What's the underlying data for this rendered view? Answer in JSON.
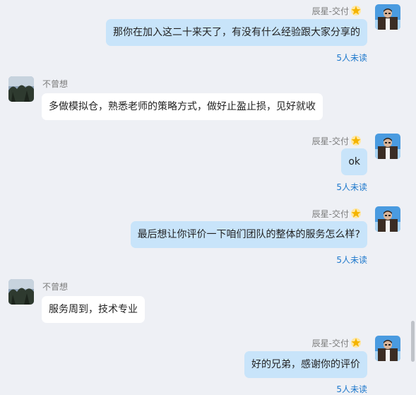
{
  "messages": [
    {
      "sender": "辰星-交付",
      "text": "那你在加入这二十来天了，有没有什么经验跟大家分享的",
      "unread": "5人未读"
    },
    {
      "sender": "不曾想",
      "text": "多做模拟仓，熟悉老师的策略方式，做好止盈止损，见好就收"
    },
    {
      "sender": "辰星-交付",
      "text": "ok",
      "unread": "5人未读"
    },
    {
      "sender": "辰星-交付",
      "text": "最后想让你评价一下咱们团队的整体的服务怎么样?",
      "unread": "5人未读"
    },
    {
      "sender": "不曾想",
      "text": "服务周到，技术专业"
    },
    {
      "sender": "辰星-交付",
      "text": "好的兄弟，感谢你的评价",
      "unread": "5人未读"
    }
  ],
  "icons": {
    "badge": "star-badge-icon",
    "self_avatar": "man-portrait-avatar",
    "other_avatar": "tree-landscape-avatar"
  }
}
